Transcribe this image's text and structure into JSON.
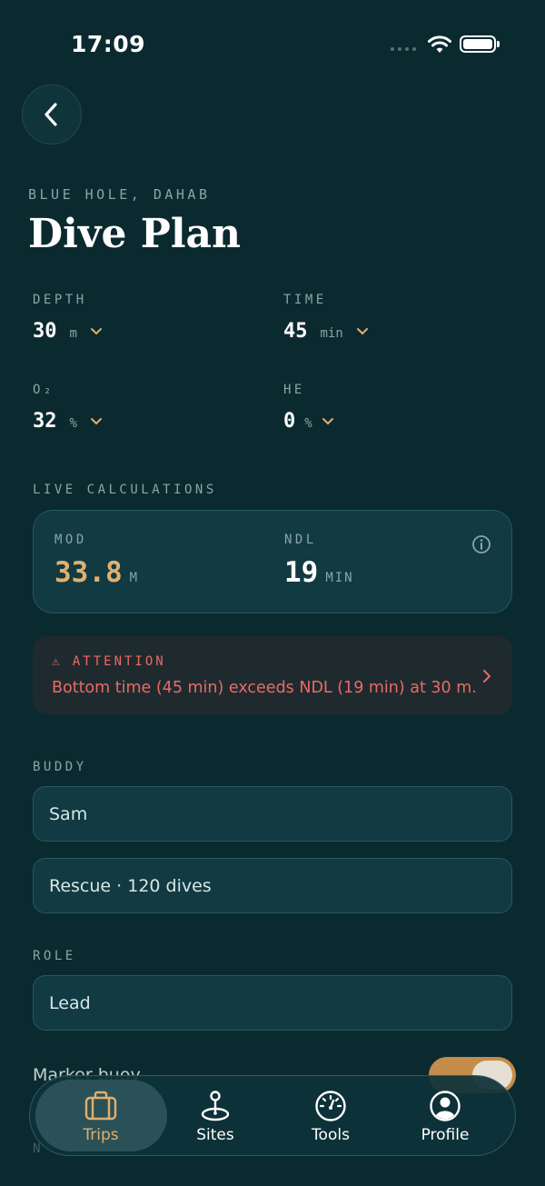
{
  "status_bar": {
    "time": "17:09"
  },
  "header": {
    "location": "BLUE HOLE, DAHAB",
    "title": "Dive Plan"
  },
  "params": {
    "depth": {
      "label": "DEPTH",
      "value": "30",
      "unit": "m"
    },
    "time": {
      "label": "TIME",
      "value": "45",
      "unit": "min"
    },
    "o2": {
      "label": "O₂",
      "value": "32",
      "unit": "%"
    },
    "he": {
      "label": "HE",
      "value": "0",
      "unit": "%"
    }
  },
  "live_calculations": {
    "label": "LIVE CALCULATIONS",
    "mod": {
      "label": "MOD",
      "value": "33.8",
      "unit": "M"
    },
    "ndl": {
      "label": "NDL",
      "value": "19",
      "unit": "MIN"
    }
  },
  "alert": {
    "title": "⚠  ATTENTION",
    "message": "Bottom time (45 min) exceeds NDL (19 min) at 30 m."
  },
  "buddy": {
    "label": "BUDDY",
    "name": "Sam",
    "cert": "Rescue · 120 dives"
  },
  "role": {
    "label": "ROLE",
    "value": "Lead"
  },
  "marker_buoy": {
    "label": "Marker buoy",
    "enabled": true
  },
  "hidden_section_label": "N",
  "tabs": [
    {
      "label": "Trips",
      "icon": "briefcase-icon",
      "active": true
    },
    {
      "label": "Sites",
      "icon": "map-pin-icon",
      "active": false
    },
    {
      "label": "Tools",
      "icon": "gauge-icon",
      "active": false
    },
    {
      "label": "Profile",
      "icon": "person-icon",
      "active": false
    }
  ],
  "colors": {
    "background": "#0b2a30",
    "card": "#113a43",
    "accent": "#e0b06e",
    "warning": "#ea6a64",
    "toggle_on": "#c48c4a"
  }
}
